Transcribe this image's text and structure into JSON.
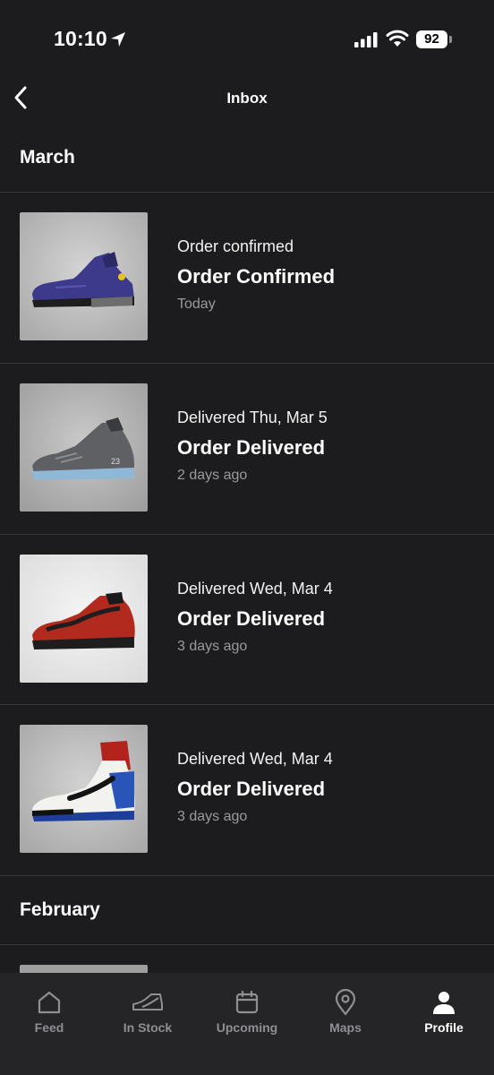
{
  "status_bar": {
    "time": "10:10",
    "battery": "92"
  },
  "nav": {
    "title": "Inbox"
  },
  "sections": [
    {
      "header": "March"
    },
    {
      "header": "February"
    }
  ],
  "items": [
    {
      "status": "Order confirmed",
      "title": "Order Confirmed",
      "time": "Today",
      "image": "purple-sneaker"
    },
    {
      "status": "Delivered Thu, Mar 5",
      "title": "Order Delivered",
      "time": "2 days ago",
      "image": "grey-sneaker"
    },
    {
      "status": "Delivered Wed, Mar 4",
      "title": "Order Delivered",
      "time": "3 days ago",
      "image": "red-black-sneaker"
    },
    {
      "status": "Delivered Wed, Mar 4",
      "title": "Order Delivered",
      "time": "3 days ago",
      "image": "red-white-blue-sneaker"
    }
  ],
  "tabs": [
    {
      "label": "Feed",
      "icon": "home-icon"
    },
    {
      "label": "In Stock",
      "icon": "shoe-icon"
    },
    {
      "label": "Upcoming",
      "icon": "calendar-icon"
    },
    {
      "label": "Maps",
      "icon": "map-pin-icon"
    },
    {
      "label": "Profile",
      "icon": "profile-icon",
      "active": true
    }
  ]
}
